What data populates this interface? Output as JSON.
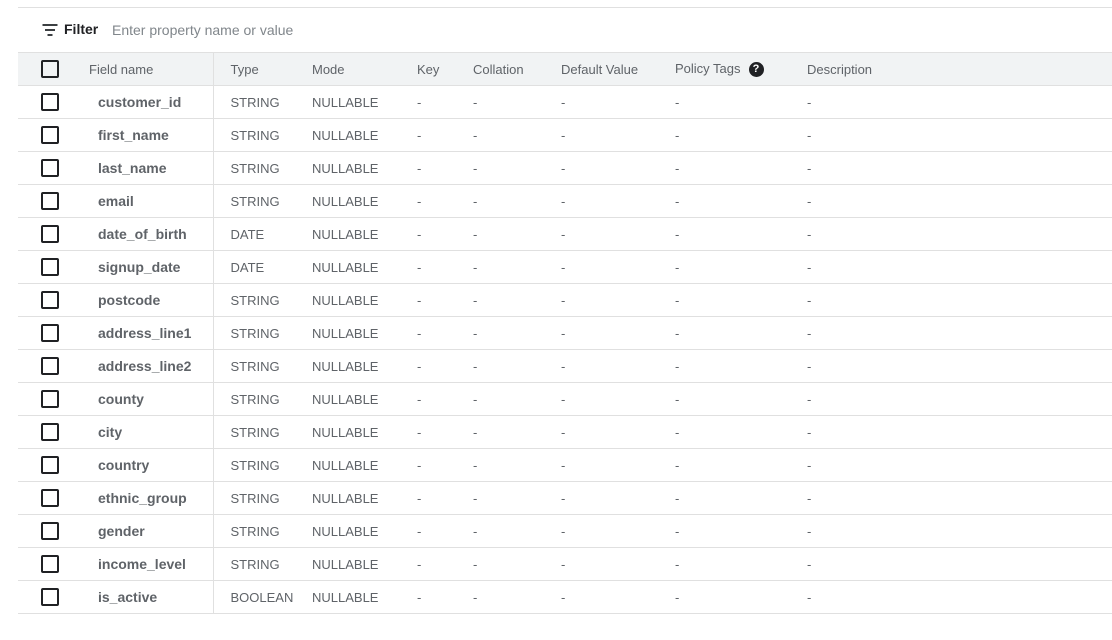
{
  "filter": {
    "label": "Filter",
    "placeholder": "Enter property name or value",
    "value": ""
  },
  "columns": {
    "field_name": "Field name",
    "type": "Type",
    "mode": "Mode",
    "key": "Key",
    "collation": "Collation",
    "default_value": "Default Value",
    "policy_tags": "Policy Tags",
    "policy_tags_help": "?",
    "description": "Description"
  },
  "rows": [
    {
      "name": "customer_id",
      "type": "STRING",
      "mode": "NULLABLE",
      "key": "-",
      "collation": "-",
      "default_value": "-",
      "policy_tags": "-",
      "description": "-"
    },
    {
      "name": "first_name",
      "type": "STRING",
      "mode": "NULLABLE",
      "key": "-",
      "collation": "-",
      "default_value": "-",
      "policy_tags": "-",
      "description": "-"
    },
    {
      "name": "last_name",
      "type": "STRING",
      "mode": "NULLABLE",
      "key": "-",
      "collation": "-",
      "default_value": "-",
      "policy_tags": "-",
      "description": "-"
    },
    {
      "name": "email",
      "type": "STRING",
      "mode": "NULLABLE",
      "key": "-",
      "collation": "-",
      "default_value": "-",
      "policy_tags": "-",
      "description": "-"
    },
    {
      "name": "date_of_birth",
      "type": "DATE",
      "mode": "NULLABLE",
      "key": "-",
      "collation": "-",
      "default_value": "-",
      "policy_tags": "-",
      "description": "-"
    },
    {
      "name": "signup_date",
      "type": "DATE",
      "mode": "NULLABLE",
      "key": "-",
      "collation": "-",
      "default_value": "-",
      "policy_tags": "-",
      "description": "-"
    },
    {
      "name": "postcode",
      "type": "STRING",
      "mode": "NULLABLE",
      "key": "-",
      "collation": "-",
      "default_value": "-",
      "policy_tags": "-",
      "description": "-"
    },
    {
      "name": "address_line1",
      "type": "STRING",
      "mode": "NULLABLE",
      "key": "-",
      "collation": "-",
      "default_value": "-",
      "policy_tags": "-",
      "description": "-"
    },
    {
      "name": "address_line2",
      "type": "STRING",
      "mode": "NULLABLE",
      "key": "-",
      "collation": "-",
      "default_value": "-",
      "policy_tags": "-",
      "description": "-"
    },
    {
      "name": "county",
      "type": "STRING",
      "mode": "NULLABLE",
      "key": "-",
      "collation": "-",
      "default_value": "-",
      "policy_tags": "-",
      "description": "-"
    },
    {
      "name": "city",
      "type": "STRING",
      "mode": "NULLABLE",
      "key": "-",
      "collation": "-",
      "default_value": "-",
      "policy_tags": "-",
      "description": "-"
    },
    {
      "name": "country",
      "type": "STRING",
      "mode": "NULLABLE",
      "key": "-",
      "collation": "-",
      "default_value": "-",
      "policy_tags": "-",
      "description": "-"
    },
    {
      "name": "ethnic_group",
      "type": "STRING",
      "mode": "NULLABLE",
      "key": "-",
      "collation": "-",
      "default_value": "-",
      "policy_tags": "-",
      "description": "-"
    },
    {
      "name": "gender",
      "type": "STRING",
      "mode": "NULLABLE",
      "key": "-",
      "collation": "-",
      "default_value": "-",
      "policy_tags": "-",
      "description": "-"
    },
    {
      "name": "income_level",
      "type": "STRING",
      "mode": "NULLABLE",
      "key": "-",
      "collation": "-",
      "default_value": "-",
      "policy_tags": "-",
      "description": "-"
    },
    {
      "name": "is_active",
      "type": "BOOLEAN",
      "mode": "NULLABLE",
      "key": "-",
      "collation": "-",
      "default_value": "-",
      "policy_tags": "-",
      "description": "-"
    }
  ]
}
